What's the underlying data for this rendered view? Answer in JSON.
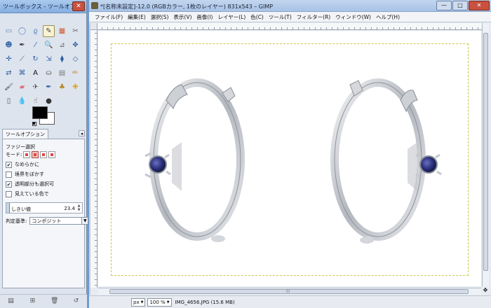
{
  "toolbox": {
    "title": "ツールボックス - ツールオプ...",
    "close": "✕",
    "tools": [
      {
        "name": "rect-select-icon",
        "glyph": "▭",
        "color": "#5b7fb8"
      },
      {
        "name": "ellipse-select-icon",
        "glyph": "◯",
        "color": "#5b7fb8"
      },
      {
        "name": "free-select-icon",
        "glyph": "ϱ",
        "color": "#5b7fb8"
      },
      {
        "name": "fuzzy-select-icon",
        "glyph": "✎",
        "color": "#444444"
      },
      {
        "name": "by-color-select-icon",
        "glyph": "▦",
        "color": "#d05a2a"
      },
      {
        "name": "scissors-select-icon",
        "glyph": "✂",
        "color": "#666666"
      },
      {
        "name": "foreground-select-icon",
        "glyph": "☻",
        "color": "#3a6aa8"
      },
      {
        "name": "paths-icon",
        "glyph": "✒",
        "color": "#333333"
      },
      {
        "name": "color-picker-icon",
        "glyph": "⁄",
        "color": "#2f5f9f"
      },
      {
        "name": "zoom-icon",
        "glyph": "🔍",
        "color": "#333333"
      },
      {
        "name": "measure-icon",
        "glyph": "⊿",
        "color": "#666666"
      },
      {
        "name": "move-icon",
        "glyph": "✥",
        "color": "#2f5f9f"
      },
      {
        "name": "align-icon",
        "glyph": "✛",
        "color": "#2f5f9f"
      },
      {
        "name": "crop-icon",
        "glyph": "⟋",
        "color": "#555555"
      },
      {
        "name": "rotate-icon",
        "glyph": "↻",
        "color": "#2f5f9f"
      },
      {
        "name": "scale-icon",
        "glyph": "⇲",
        "color": "#2f5f9f"
      },
      {
        "name": "shear-icon",
        "glyph": "⧫",
        "color": "#2f5f9f"
      },
      {
        "name": "perspective-icon",
        "glyph": "◇",
        "color": "#2f5f9f"
      },
      {
        "name": "flip-icon",
        "glyph": "⇄",
        "color": "#2f5f9f"
      },
      {
        "name": "cage-icon",
        "glyph": "⌘",
        "color": "#2f5f9f"
      },
      {
        "name": "text-icon",
        "glyph": "A",
        "color": "#111111"
      },
      {
        "name": "bucket-fill-icon",
        "glyph": "⛀",
        "color": "#555555"
      },
      {
        "name": "blend-icon",
        "glyph": "▤",
        "color": "#777777"
      },
      {
        "name": "pencil-icon",
        "glyph": "✏",
        "color": "#c8882a"
      },
      {
        "name": "paintbrush-icon",
        "glyph": "🖌",
        "color": "#333333"
      },
      {
        "name": "eraser-icon",
        "glyph": "▰",
        "color": "#e07080"
      },
      {
        "name": "airbrush-icon",
        "glyph": "✈",
        "color": "#555555"
      },
      {
        "name": "ink-icon",
        "glyph": "✒",
        "color": "#2f5f9f"
      },
      {
        "name": "clone-icon",
        "glyph": "♣",
        "color": "#b8862a"
      },
      {
        "name": "heal-icon",
        "glyph": "✚",
        "color": "#e0a020"
      },
      {
        "name": "perspective-clone-icon",
        "glyph": "▯",
        "color": "#555555"
      },
      {
        "name": "blur-icon",
        "glyph": "💧",
        "color": "#3a7acc"
      },
      {
        "name": "smudge-icon",
        "glyph": "☝",
        "color": "#555555"
      },
      {
        "name": "dodge-burn-icon",
        "glyph": "●",
        "color": "#333333"
      }
    ],
    "panel_tab": "ツールオプション",
    "panel_menu": "◂",
    "options_heading": "ファジー選択",
    "mode_label": "モード:",
    "checkboxes": [
      {
        "label": "なめらかに",
        "checked": true
      },
      {
        "label": "境界をぼかす",
        "checked": false
      },
      {
        "label": "透明部分も選択可",
        "checked": true
      },
      {
        "label": "見えている色で",
        "checked": false
      }
    ],
    "threshold_label": "しきい値",
    "threshold_value": "23.4",
    "criterion_label": "判定基準:",
    "criterion_value": "コンポジット",
    "bottom_buttons": [
      {
        "name": "save-preset-icon",
        "glyph": "▤"
      },
      {
        "name": "restore-preset-icon",
        "glyph": "⊞"
      },
      {
        "name": "delete-preset-icon",
        "glyph": "🗑"
      },
      {
        "name": "reset-options-icon",
        "glyph": "↺"
      }
    ]
  },
  "image_window": {
    "title": "*[名称未設定]-12.0 (RGBカラー, 1枚のレイヤー) 831x543 – GIMP",
    "window_buttons": {
      "minimize": "—",
      "maximize": "□",
      "close": "✕"
    },
    "menu": [
      "ファイル(F)",
      "編集(E)",
      "選択(S)",
      "表示(V)",
      "画像(I)",
      "レイヤー(L)",
      "色(C)",
      "ツール(T)",
      "フィルター(R)",
      "ウィンドウ(W)",
      "ヘルプ(H)"
    ],
    "status": {
      "unit": "px",
      "zoom": "100 %",
      "info": "IMG_4656.JPG (15.6 MB)"
    },
    "colors": {
      "gem": "#2a2f7a",
      "metal": "#c9ccd2",
      "guide": "#c8c84a"
    }
  }
}
